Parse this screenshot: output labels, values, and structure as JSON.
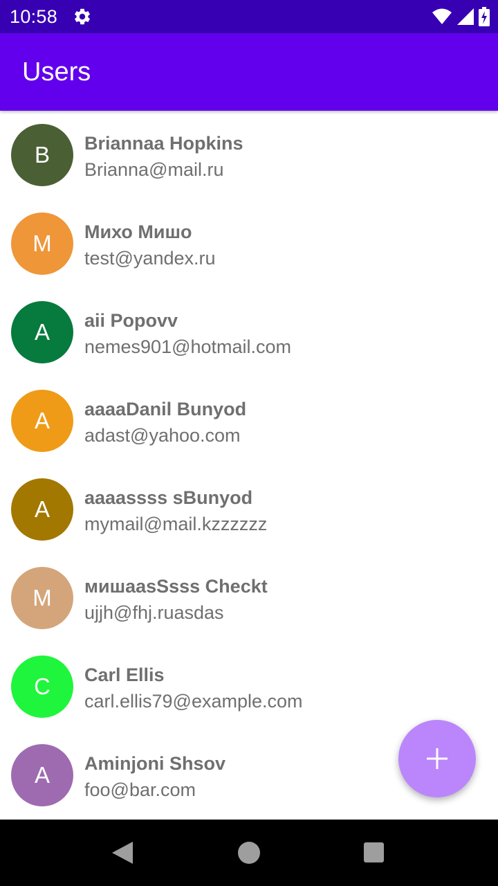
{
  "status_bar": {
    "time": "10:58",
    "icons": [
      "gear-icon",
      "wifi-icon",
      "signal-icon",
      "battery-charging-icon"
    ],
    "color": "#3700b3"
  },
  "app_bar": {
    "title": "Users",
    "color": "#6200ee"
  },
  "users": [
    {
      "initial": "B",
      "name": "Briannaa Hopkins",
      "email": "Brianna@mail.ru",
      "avatar_color": "#4b5f34"
    },
    {
      "initial": "M",
      "name": "Михо Мишо",
      "email": "test@yandex.ru",
      "avatar_color": "#ef9639"
    },
    {
      "initial": "A",
      "name": "aii Popovv",
      "email": "nemes901@hotmail.com",
      "avatar_color": "#077a3e"
    },
    {
      "initial": "A",
      "name": "aaaaDanil Bunyod",
      "email": "adast@yahoo.com",
      "avatar_color": "#ef9b17"
    },
    {
      "initial": "A",
      "name": "aaaassss sBunyod",
      "email": "mymail@mail.kzzzzzz",
      "avatar_color": "#a37800"
    },
    {
      "initial": "M",
      "name": "мишааsSsss Checkt",
      "email": "ujjh@fhj.ruasdas",
      "avatar_color": "#d4a57b"
    },
    {
      "initial": "C",
      "name": "Carl Ellis",
      "email": "carl.ellis79@example.com",
      "avatar_color": "#1ff53c"
    },
    {
      "initial": "A",
      "name": "Aminjoni Shsov",
      "email": "foo@bar.com",
      "avatar_color": "#9e6bb1"
    }
  ],
  "fab": {
    "icon": "plus-icon",
    "color": "#bb86fc"
  },
  "nav_bar": {
    "icons": [
      "back-icon",
      "home-icon",
      "recents-icon"
    ]
  }
}
